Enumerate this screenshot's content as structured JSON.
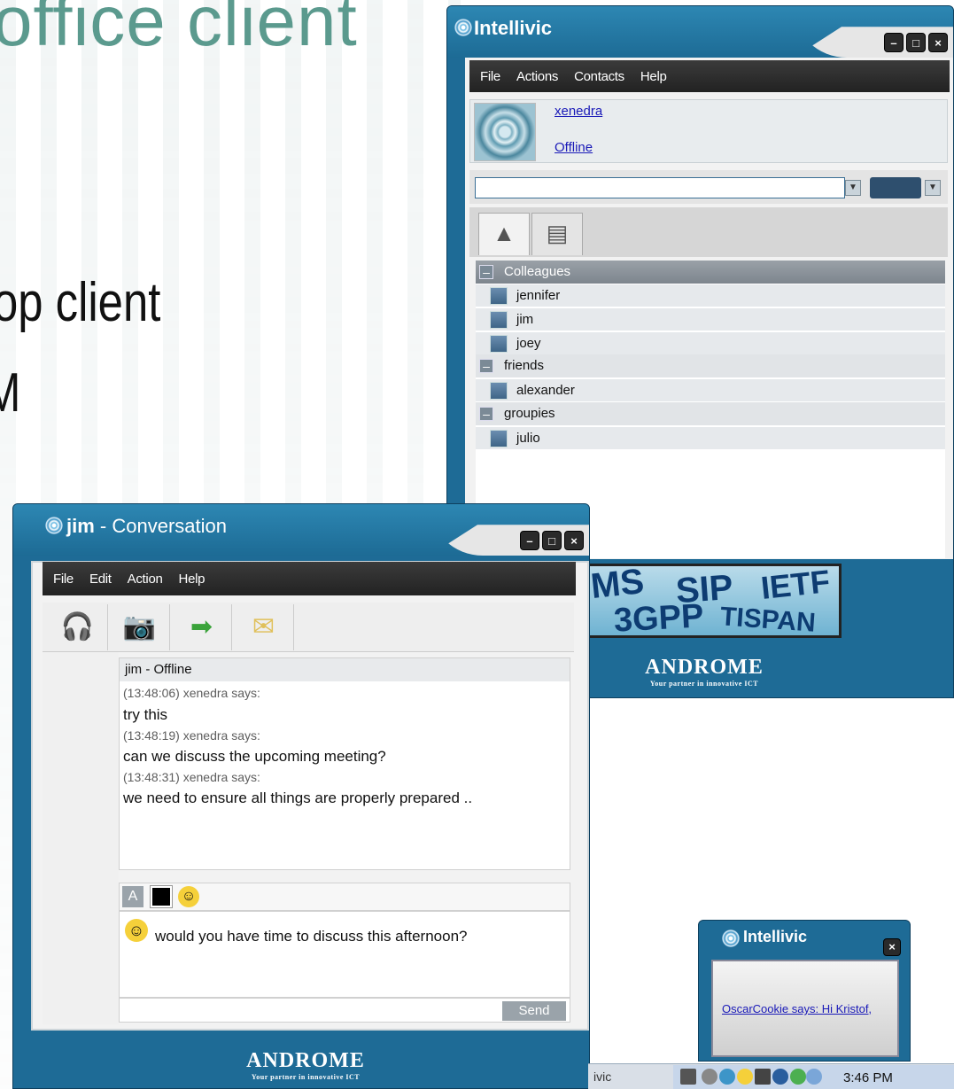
{
  "slide": {
    "title_fragment": "office client",
    "bullet1_fragment": "op client",
    "bullet2_fragment": "M"
  },
  "main_window": {
    "title": "Intellivic",
    "menu": [
      "File",
      "Actions",
      "Contacts",
      "Help"
    ],
    "user": {
      "name": "xenedra",
      "status": "Offline"
    },
    "search": {
      "value": ""
    },
    "groups": [
      {
        "name": "Colleagues",
        "contacts": [
          "jennifer",
          "jim",
          "joey"
        ]
      },
      {
        "name": "friends",
        "contacts": [
          "alexander"
        ]
      },
      {
        "name": "groupies",
        "contacts": [
          "julio"
        ]
      }
    ],
    "banner_words": [
      "MS",
      "SIP",
      "IETF",
      "3GPP",
      "TISPAN"
    ],
    "brand": {
      "name": "ANDROME",
      "tagline": "Your partner in innovative ICT"
    }
  },
  "conversation_window": {
    "title_name": "jim",
    "title_suffix": " - Conversation",
    "menu": [
      "File",
      "Edit",
      "Action",
      "Help"
    ],
    "chat_header": "jim - Offline",
    "messages": [
      {
        "meta": "(13:48:06) xenedra says:",
        "text": "try this"
      },
      {
        "meta": "(13:48:19) xenedra says:",
        "text": "can we discuss the upcoming meeting?"
      },
      {
        "meta": "(13:48:31) xenedra says:",
        "text": "we need to ensure all things are properly prepared .."
      }
    ],
    "format_font_label": "A",
    "input_text": "would you have time to discuss this afternoon?",
    "send_label": "Send",
    "brand": {
      "name": "ANDROME",
      "tagline": "Your partner in innovative ICT"
    }
  },
  "notification": {
    "title": "Intellivic",
    "message": "OscarCookie says: Hi Kristof,"
  },
  "taskbar": {
    "item_fragment": "ivic",
    "clock": "3:46 PM"
  },
  "colors": {
    "window_blue": "#1e6b96",
    "menu_dark": "#2b2b2b",
    "slide_teal": "#5b9a8e"
  }
}
